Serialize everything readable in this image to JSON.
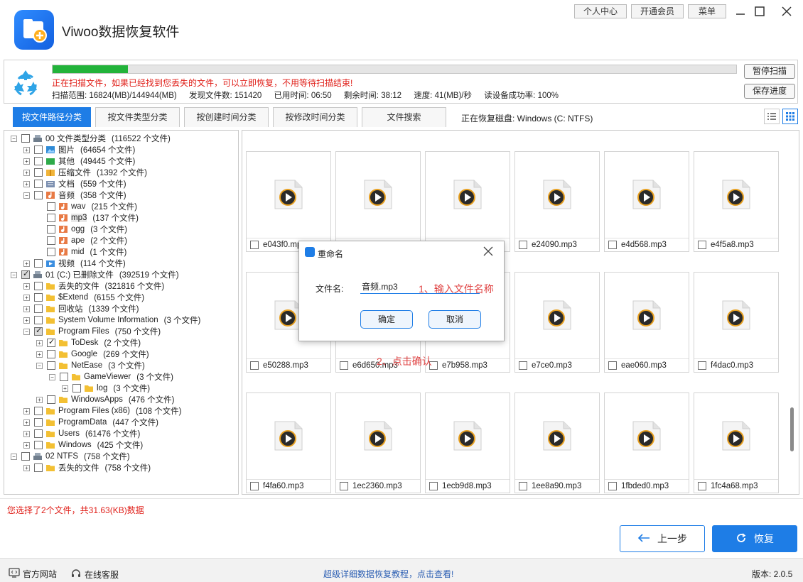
{
  "app": {
    "title": "Viwoo数据恢复软件",
    "top_buttons": [
      "个人中心",
      "开通会员",
      "菜单"
    ]
  },
  "scan": {
    "progress_percent": 11,
    "message": "正在扫描文件，如果已经找到您丢失的文件，可以立即恢复，不用等待扫描结束!",
    "range": "扫描范围: 16824(MB)/144944(MB)",
    "found": "发现文件数: 151420",
    "elapsed": "已用时间: 06:50",
    "remaining": "剩余时间: 38:12",
    "speed": "速度: 41(MB)/秒",
    "success_rate": "读设备成功率: 100%",
    "pause_label": "暂停扫描",
    "save_label": "保存进度"
  },
  "tabs": [
    "按文件路径分类",
    "按文件类型分类",
    "按创建时间分类",
    "按修改时间分类",
    "文件搜索"
  ],
  "recovering_disk": "正在恢复磁盘: Windows (C: NTFS)",
  "tree": [
    {
      "label": "00 文件类型分类",
      "count": "(116522 个文件)",
      "depth": 0,
      "icon": "drive-icon",
      "check": "none",
      "expander": "minus"
    },
    {
      "label": "图片",
      "count": "(64654 个文件)",
      "depth": 1,
      "icon": "image-icon",
      "check": "none",
      "expander": "plus"
    },
    {
      "label": "其他",
      "count": "(49445 个文件)",
      "depth": 1,
      "icon": "other-icon",
      "check": "none",
      "expander": "plus"
    },
    {
      "label": "压缩文件",
      "count": "(1392 个文件)",
      "depth": 1,
      "icon": "archive-icon",
      "check": "none",
      "expander": "plus"
    },
    {
      "label": "文档",
      "count": "(559 个文件)",
      "depth": 1,
      "icon": "document-icon",
      "check": "none",
      "expander": "plus"
    },
    {
      "label": "音频",
      "count": "(358 个文件)",
      "depth": 1,
      "icon": "audio-icon",
      "check": "none",
      "expander": "minus"
    },
    {
      "label": "wav",
      "count": "(215 个文件)",
      "depth": 2,
      "icon": "audio-icon",
      "check": "none",
      "expander": ""
    },
    {
      "label": "mp3",
      "count": "(137 个文件)",
      "depth": 2,
      "icon": "audio-icon",
      "check": "none",
      "expander": "",
      "selected": true
    },
    {
      "label": "ogg",
      "count": "(3 个文件)",
      "depth": 2,
      "icon": "audio-icon",
      "check": "none",
      "expander": ""
    },
    {
      "label": "ape",
      "count": "(2 个文件)",
      "depth": 2,
      "icon": "audio-icon",
      "check": "none",
      "expander": ""
    },
    {
      "label": "mid",
      "count": "(1 个文件)",
      "depth": 2,
      "icon": "audio-icon",
      "check": "none",
      "expander": ""
    },
    {
      "label": "视频",
      "count": "(114 个文件)",
      "depth": 1,
      "icon": "video-icon",
      "check": "none",
      "expander": "plus"
    },
    {
      "label": "01 (C:) 已删除文件",
      "count": "(392519 个文件)",
      "depth": 0,
      "icon": "drive-icon",
      "check": "partial",
      "expander": "minus"
    },
    {
      "label": "丢失的文件",
      "count": "(321816 个文件)",
      "depth": 1,
      "icon": "folder-icon",
      "check": "none",
      "expander": "plus"
    },
    {
      "label": "$Extend",
      "count": "(6155 个文件)",
      "depth": 1,
      "icon": "folder-icon",
      "check": "none",
      "expander": "plus"
    },
    {
      "label": "回收站",
      "count": "(1339 个文件)",
      "depth": 1,
      "icon": "folder-icon",
      "check": "none",
      "expander": "plus"
    },
    {
      "label": "System Volume Information",
      "count": "(3 个文件)",
      "depth": 1,
      "icon": "folder-icon",
      "check": "none",
      "expander": "plus"
    },
    {
      "label": "Program Files",
      "count": "(750 个文件)",
      "depth": 1,
      "icon": "folder-icon",
      "check": "partial",
      "expander": "minus"
    },
    {
      "label": "ToDesk",
      "count": "(2 个文件)",
      "depth": 2,
      "icon": "folder-icon",
      "check": "checked",
      "expander": "plus"
    },
    {
      "label": "Google",
      "count": "(269 个文件)",
      "depth": 2,
      "icon": "folder-icon",
      "check": "none",
      "expander": "plus"
    },
    {
      "label": "NetEase",
      "count": "(3 个文件)",
      "depth": 2,
      "icon": "folder-icon",
      "check": "none",
      "expander": "minus"
    },
    {
      "label": "GameViewer",
      "count": "(3 个文件)",
      "depth": 3,
      "icon": "folder-icon",
      "check": "none",
      "expander": "minus"
    },
    {
      "label": "log",
      "count": "(3 个文件)",
      "depth": 4,
      "icon": "folder-icon",
      "check": "none",
      "expander": "plus"
    },
    {
      "label": "WindowsApps",
      "count": "(476 个文件)",
      "depth": 2,
      "icon": "folder-icon",
      "check": "none",
      "expander": "plus"
    },
    {
      "label": "Program Files (x86)",
      "count": "(108 个文件)",
      "depth": 1,
      "icon": "folder-icon",
      "check": "none",
      "expander": "plus"
    },
    {
      "label": "ProgramData",
      "count": "(447 个文件)",
      "depth": 1,
      "icon": "folder-icon",
      "check": "none",
      "expander": "plus"
    },
    {
      "label": "Users",
      "count": "(61476 个文件)",
      "depth": 1,
      "icon": "folder-icon",
      "check": "none",
      "expander": "plus"
    },
    {
      "label": "Windows",
      "count": "(425 个文件)",
      "depth": 1,
      "icon": "folder-icon",
      "check": "none",
      "expander": "plus"
    },
    {
      "label": "02  NTFS",
      "count": "(758 个文件)",
      "depth": 0,
      "icon": "drive-icon",
      "check": "none",
      "expander": "minus"
    },
    {
      "label": "丢失的文件",
      "count": "(758 个文件)",
      "depth": 1,
      "icon": "folder-icon",
      "check": "none",
      "expander": "plus"
    }
  ],
  "files": [
    "e043f0.mp3",
    "",
    "",
    "e24090.mp3",
    "e4d568.mp3",
    "e4f5a8.mp3",
    "e50288.mp3",
    "e6d650.mp3",
    "e7b958.mp3",
    "e7ce0.mp3",
    "eae060.mp3",
    "f4dac0.mp3",
    "f4fa60.mp3",
    "1ec2360.mp3",
    "1ecb9d8.mp3",
    "1ee8a90.mp3",
    "1fbded0.mp3",
    "1fc4a68.mp3"
  ],
  "dialog": {
    "title": "重命名",
    "field_label": "文件名:",
    "field_value": "音频.mp3",
    "ok_label": "确定",
    "cancel_label": "取消"
  },
  "annotations": {
    "step1": "1、输入文件名称",
    "step2": "2、点击确认"
  },
  "bottom": {
    "selection_info": "您选择了2个文件，共31.63(KB)数据",
    "prev_label": "上一步",
    "recover_label": "恢复",
    "website_label": "官方网站",
    "support_label": "在线客服",
    "tutorial_link": "超级详细数据恢复教程，点击查看!",
    "version": "版本: 2.0.5"
  },
  "colors": {
    "accent": "#1e7de6",
    "warning_text": "#e0201a",
    "progress": "#22b33a",
    "annotation": "#e04545"
  }
}
